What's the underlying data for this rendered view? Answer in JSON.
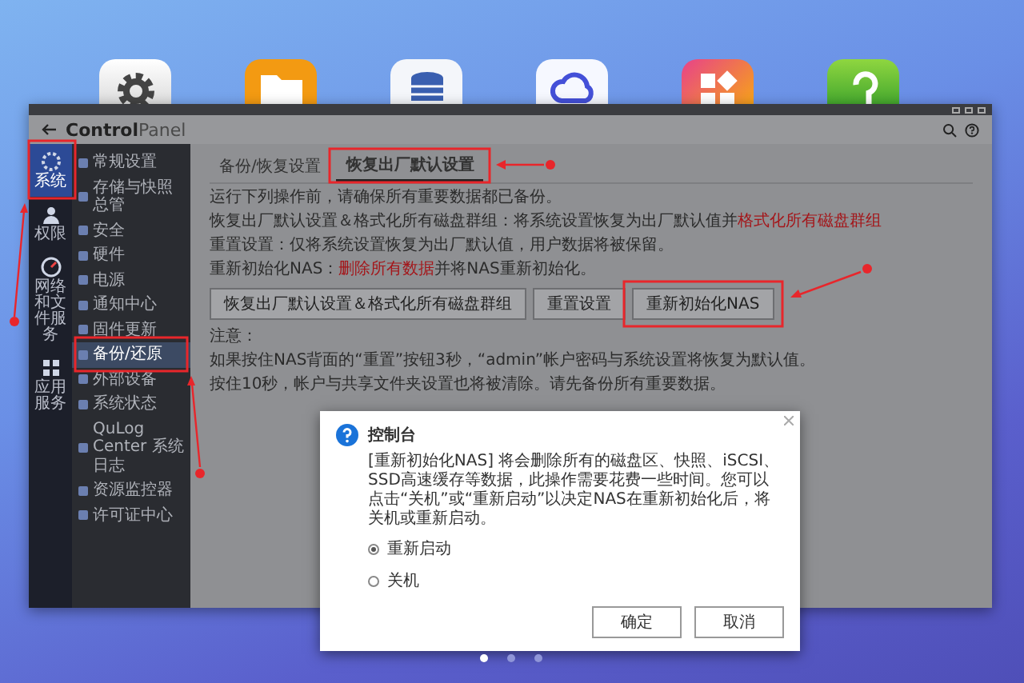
{
  "desktop": {
    "apps": [
      {
        "kind": "gear"
      },
      {
        "kind": "folder"
      },
      {
        "kind": "database"
      },
      {
        "kind": "cloud"
      },
      {
        "kind": "grid"
      },
      {
        "kind": "hook"
      }
    ]
  },
  "window": {
    "app_title": {
      "main": "Control",
      "sub": "Panel"
    }
  },
  "categories": [
    {
      "label": "系统",
      "kind": "system",
      "selected": true
    },
    {
      "label": "权限",
      "kind": "users",
      "selected": false
    },
    {
      "label": "网络和文件服务",
      "kind": "network",
      "selected": false
    },
    {
      "label": "应用服务",
      "kind": "apps",
      "selected": false
    }
  ],
  "menu": [
    {
      "label": "常规设置",
      "selected": false
    },
    {
      "label": "存储与快照总管",
      "selected": false
    },
    {
      "label": "安全",
      "selected": false
    },
    {
      "label": "硬件",
      "selected": false
    },
    {
      "label": "电源",
      "selected": false
    },
    {
      "label": "通知中心",
      "selected": false
    },
    {
      "label": "固件更新",
      "selected": false
    },
    {
      "label": "备份/还原",
      "selected": true
    },
    {
      "label": "外部设备",
      "selected": false
    },
    {
      "label": "系统状态",
      "selected": false
    },
    {
      "label": "QuLog Center 系统日志",
      "selected": false
    },
    {
      "label": "资源监控器",
      "selected": false
    },
    {
      "label": "许可证中心",
      "selected": false
    }
  ],
  "tabs": [
    {
      "label": "备份/恢复设置",
      "selected": false
    },
    {
      "label": "恢复出厂默认设置",
      "selected": true
    }
  ],
  "paragraphs": [
    [
      {
        "text": "运行下列操作前，请确保所有重要数据都已备份。",
        "kind": "normal"
      }
    ],
    [
      {
        "text": "恢复出厂默认设置＆格式化所有磁盘群组：将系统设置恢复为出厂默认值并",
        "kind": "normal"
      },
      {
        "text": "格式化所有磁盘群组",
        "kind": "warning"
      }
    ],
    [
      {
        "text": "重置设置：仅将系统设置恢复为出厂默认值，用户数据将被保留。",
        "kind": "normal"
      }
    ],
    [
      {
        "text": "重新初始化NAS：",
        "kind": "normal"
      },
      {
        "text": "删除所有数据",
        "kind": "warning"
      },
      {
        "text": "并将NAS重新初始化。",
        "kind": "normal"
      }
    ]
  ],
  "buttons": [
    "恢复出厂默认设置＆格式化所有磁盘群组",
    "重置设置",
    "重新初始化NAS"
  ],
  "note": {
    "heading": "注意：",
    "lines": [
      "如果按住NAS背面的“重置”按钮3秒，“admin”帐户密码与系统设置将恢复为默认值。",
      "按住10秒，帐户与共享文件夹设置也将被清除。请先备份所有重要数据。"
    ]
  },
  "dialog": {
    "title": "控制台",
    "message": "[重新初始化NAS] 将会删除所有的磁盘区、快照、iSCSI、SSD高速缓存等数据，此操作需要花费一些时间。您可以点击“关机”或“重新启动”以决定NAS在重新初始化后，将关机或重新启动。",
    "options": [
      {
        "label": "重新启动",
        "selected": true
      },
      {
        "label": "关机",
        "selected": false
      }
    ],
    "buttons": [
      "确定",
      "取消"
    ]
  },
  "page_dots": [
    {
      "selected": true
    },
    {
      "selected": false
    },
    {
      "selected": false
    }
  ]
}
